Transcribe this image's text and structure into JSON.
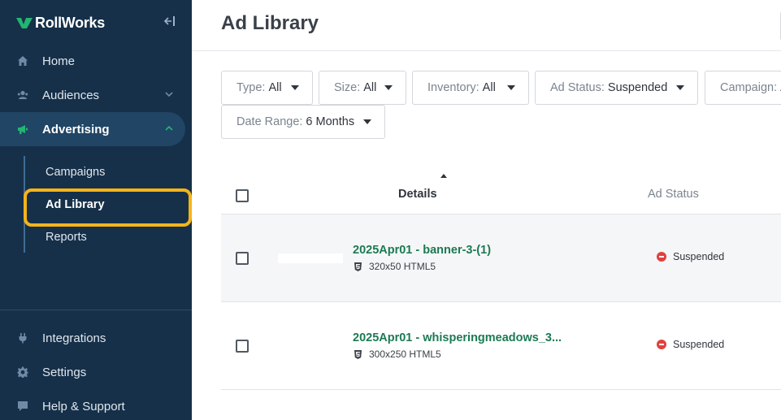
{
  "brand": {
    "name": "RollWorks",
    "accent": "#22b573",
    "sidebar_bg": "#163049",
    "highlight": "#f6b419"
  },
  "sidebar": {
    "collapse_icon": "collapse-left-icon",
    "items": [
      {
        "label": "Home",
        "icon": "home-icon"
      },
      {
        "label": "Audiences",
        "icon": "audiences-icon"
      },
      {
        "label": "Advertising",
        "icon": "megaphone-icon"
      },
      {
        "label": "Integrations",
        "icon": "plug-icon"
      },
      {
        "label": "Settings",
        "icon": "gear-icon"
      },
      {
        "label": "Help & Support",
        "icon": "help-icon"
      }
    ],
    "sub_items": [
      {
        "label": "Campaigns"
      },
      {
        "label": "Ad Library"
      },
      {
        "label": "Reports"
      }
    ]
  },
  "main": {
    "title": "Ad Library",
    "filters": [
      {
        "label": "Type:",
        "value": "All"
      },
      {
        "label": "Size:",
        "value": "All"
      },
      {
        "label": "Inventory:",
        "value": "All"
      },
      {
        "label": "Ad Status:",
        "value": "Suspended"
      },
      {
        "label": "Campaign:",
        "value": "A"
      },
      {
        "label": "Date Range:",
        "value": "6 Months"
      }
    ],
    "table": {
      "columns": {
        "details": "Details",
        "status": "Ad Status"
      },
      "rows": [
        {
          "name": "2025Apr01 - banner-3-(1)",
          "meta": "320x50 HTML5",
          "status": "Suspended"
        },
        {
          "name": "2025Apr01 - whisperingmeadows_3...",
          "meta": "300x250 HTML5",
          "status": "Suspended"
        }
      ]
    }
  }
}
